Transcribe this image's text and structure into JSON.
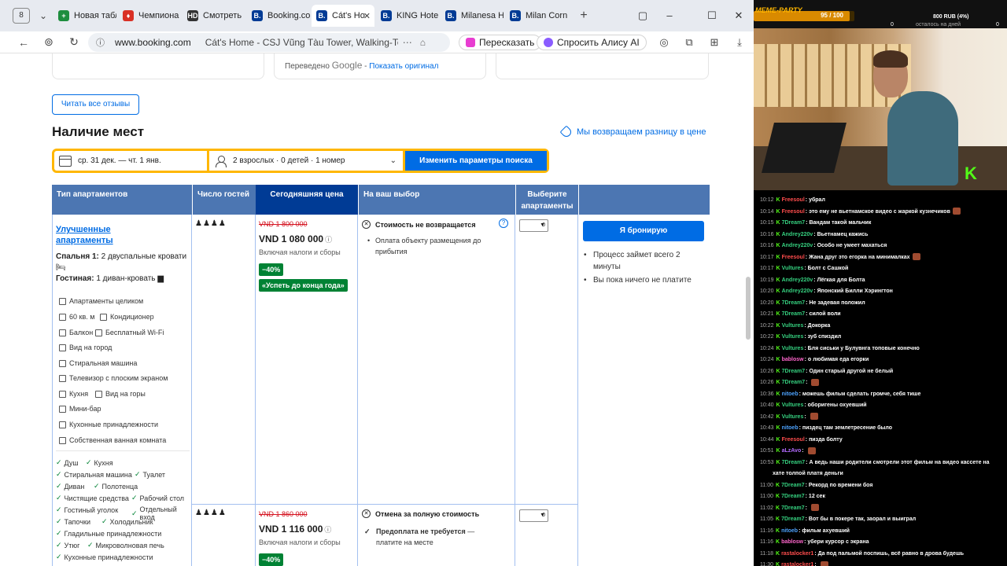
{
  "browser": {
    "tab_count": "8",
    "tabs": [
      {
        "label": "Новая табл",
        "fav_color": "#1e8e3e",
        "fav_glyph": "+"
      },
      {
        "label": "Чемпиона",
        "fav_color": "#d93025",
        "fav_glyph": "♦"
      },
      {
        "label": "Смотреть",
        "fav_color": "#333333",
        "fav_glyph": "HD"
      },
      {
        "label": "Booking.co",
        "fav_color": "#003b95",
        "fav_glyph": "B."
      },
      {
        "label": "Cát's Ho",
        "fav_color": "#003b95",
        "fav_glyph": "B."
      },
      {
        "label": "KING Hote",
        "fav_color": "#003b95",
        "fav_glyph": "B."
      },
      {
        "label": "Milanesa H",
        "fav_color": "#003b95",
        "fav_glyph": "B."
      },
      {
        "label": "Milan Corn",
        "fav_color": "#003b95",
        "fav_glyph": "B."
      }
    ],
    "url_domain": "www.booking.com",
    "page_title": "Cát's Home - CSJ Vũng Tàu Tower, Walking-To-...",
    "btn_retell": "Пересказать",
    "btn_alice": "Спросить Алису AI"
  },
  "reviews": {
    "translated_prefix": "Переведено",
    "translated_google": "Google",
    "show_original": "Показать оригинал",
    "read_all": "Читать все отзывы"
  },
  "availability": {
    "title": "Наличие мест",
    "price_match": "Мы возвращаем разницу в цене",
    "dates": "ср. 31 дек.  —  чт. 1 янв.",
    "guests": "2 взрослых · 0 детей · 1 номер",
    "submit": "Изменить параметры поиска"
  },
  "table": {
    "headers": {
      "type": "Тип апартаментов",
      "guests": "Число гостей",
      "price": "Сегодняшняя цена",
      "choice": "На ваш выбор",
      "select": "Выберите апартаменты"
    },
    "room": {
      "name": "Улучшенные апартаменты",
      "bedroom_label": "Спальня 1:",
      "bedroom_value": "2 двуспальные кровати",
      "living_label": "Гостиная:",
      "living_value": "1 диван-кровать",
      "amenities": [
        "Апартаменты целиком",
        "60 кв. м",
        "Кондиционер",
        "Балкон",
        "Бесплатный Wi-Fi",
        "Вид на город",
        "Стиральная машина",
        "Телевизор с плоским экраном",
        "Кухня",
        "Вид на горы",
        "Мини-бар",
        "Кухонные принадлежности",
        "Собственная ванная комната"
      ],
      "features": [
        "Душ",
        "Кухня",
        "Стиральная машина",
        "Туалет",
        "Диван",
        "Полотенца",
        "Чистящие средства",
        "Рабочий стол",
        "Гостиный уголок",
        "Отдельный вход",
        "Тапочки",
        "Холодильник",
        "Гладильные принадлежности",
        "Утюг",
        "Микроволновая печь",
        "Кухонные принадлежности"
      ]
    },
    "options": [
      {
        "occupancy": "♟♟♟♟",
        "old_price": "VND 1 800 000",
        "price": "VND 1 080 000",
        "taxes": "Включая налоги и сборы",
        "discount": "−40%",
        "deal": "«Успеть до конца года»",
        "policy": "Стоимость не возвращается",
        "policy_note": "Оплата объекту размещения до прибытия",
        "qty": "0"
      },
      {
        "occupancy": "♟♟♟♟",
        "old_price": "VND 1 860 000",
        "price": "VND 1 116 000",
        "taxes": "Включая налоги и сборы",
        "discount": "−40%",
        "policy": "Отмена за полную стоимость",
        "policy_note_bold": "Предоплата не требуется",
        "policy_note": "— платите на месте",
        "qty": "0"
      }
    ],
    "reserve_button": "Я бронирую",
    "reserve_notes": [
      "Процесс займет всего 2 минуты",
      "Вы пока ничего не платите"
    ]
  },
  "stream": {
    "meme_label": "MEME-PARTY",
    "meme_value": "95 / 100",
    "meme_progress": 0.95,
    "top_left": "0",
    "rub_label": "800 RUB (4%)",
    "rub_left": "0",
    "rub_sub": "осталось на дней",
    "chat": [
      {
        "t": "10:12",
        "u": "Freesoul",
        "c": "#ff4d4d",
        "m": "убрал",
        "e": false
      },
      {
        "t": "10:14",
        "u": "Freesoul",
        "c": "#ff4d4d",
        "m": "это ему не вьетнамское видео с жаркой кузнечиков",
        "e": true
      },
      {
        "t": "10:15",
        "u": "7Dream7",
        "c": "#35d07f",
        "m": "Вандам такой мальчик",
        "e": false
      },
      {
        "t": "10:16",
        "u": "Andrey220v",
        "c": "#35d07f",
        "m": "Вьетнамец кажись",
        "e": false
      },
      {
        "t": "10:16",
        "u": "Andrey220v",
        "c": "#35d07f",
        "m": "Особо не умеет махаться",
        "e": false
      },
      {
        "t": "10:17",
        "u": "Freesoul",
        "c": "#ff4d4d",
        "m": "Жана друг это егорка на минималках",
        "e": true
      },
      {
        "t": "10:17",
        "u": "Vultures",
        "c": "#35d07f",
        "m": "Болт с Сашкой",
        "e": false
      },
      {
        "t": "10:19",
        "u": "Andrey220v",
        "c": "#35d07f",
        "m": "Лёгкая для Болта",
        "e": false
      },
      {
        "t": "10:20",
        "u": "Andrey220v",
        "c": "#35d07f",
        "m": "Японский Билли Хэрингтон",
        "e": false
      },
      {
        "t": "10:20",
        "u": "7Dream7",
        "c": "#35d07f",
        "m": "Не задевая положил",
        "e": false
      },
      {
        "t": "10:21",
        "u": "7Dream7",
        "c": "#35d07f",
        "m": "силой воли",
        "e": false
      },
      {
        "t": "10:22",
        "u": "Vultures",
        "c": "#35d07f",
        "m": "Докорка",
        "e": false
      },
      {
        "t": "10:22",
        "u": "Vultures",
        "c": "#35d07f",
        "m": "зуб спиздил",
        "e": false
      },
      {
        "t": "10:24",
        "u": "Vultures",
        "c": "#35d07f",
        "m": "Бля сиськи у Булувнга топовые конечно",
        "e": false
      },
      {
        "t": "10:24",
        "u": "bablosw",
        "c": "#ff66cc",
        "m": "о любимая еда егорки",
        "e": false
      },
      {
        "t": "10:26",
        "u": "7Dream7",
        "c": "#35d07f",
        "m": "Один старый другой не белый",
        "e": false
      },
      {
        "t": "10:26",
        "u": "7Dream7",
        "c": "#35d07f",
        "m": "",
        "e": true
      },
      {
        "t": "10:36",
        "u": "nitoeb",
        "c": "#4da3ff",
        "m": "можешь фильм сделать громче, себя тише",
        "e": false
      },
      {
        "t": "10:40",
        "u": "Vultures",
        "c": "#35d07f",
        "m": "оборигены охуевший",
        "e": false
      },
      {
        "t": "10:42",
        "u": "Vultures",
        "c": "#35d07f",
        "m": "",
        "e": true
      },
      {
        "t": "10:43",
        "u": "nitoeb",
        "c": "#4da3ff",
        "m": "пиздец там землетресение было",
        "e": false
      },
      {
        "t": "10:44",
        "u": "Freesoul",
        "c": "#ff4d4d",
        "m": "пизда болту",
        "e": false
      },
      {
        "t": "10:51",
        "u": "aLzAvo",
        "c": "#b36bff",
        "m": "",
        "e": true
      },
      {
        "t": "10:53",
        "u": "7Dream7",
        "c": "#35d07f",
        "m": "А ведь наши родители смотрели этот фильм на видео кассете на",
        "e": false
      },
      {
        "t": "",
        "u": "",
        "c": "#fff",
        "m": "хате толпой платя деньги",
        "e": false
      },
      {
        "t": "11:00",
        "u": "7Dream7",
        "c": "#35d07f",
        "m": "Рекорд по времени боя",
        "e": false
      },
      {
        "t": "11:00",
        "u": "7Dream7",
        "c": "#35d07f",
        "m": "12 сек",
        "e": false
      },
      {
        "t": "11:02",
        "u": "7Dream7",
        "c": "#35d07f",
        "m": "",
        "e": true
      },
      {
        "t": "11:05",
        "u": "7Dream7",
        "c": "#35d07f",
        "m": "Вот бы в покере так, заорал и выиграл",
        "e": false
      },
      {
        "t": "11:16",
        "u": "nitoeb",
        "c": "#4da3ff",
        "m": "фильм ахуевший",
        "e": false
      },
      {
        "t": "11:16",
        "u": "bablosw",
        "c": "#ff66cc",
        "m": "убери курсор с экрана",
        "e": false
      },
      {
        "t": "11:18",
        "u": "rastalocker1",
        "c": "#ff4d4d",
        "m": "Да под пальмой поспишь, всё равно в дрова будешь",
        "e": false
      },
      {
        "t": "11:30",
        "u": "rastalocker1",
        "c": "#ff4d4d",
        "m": "",
        "e": true
      }
    ]
  }
}
